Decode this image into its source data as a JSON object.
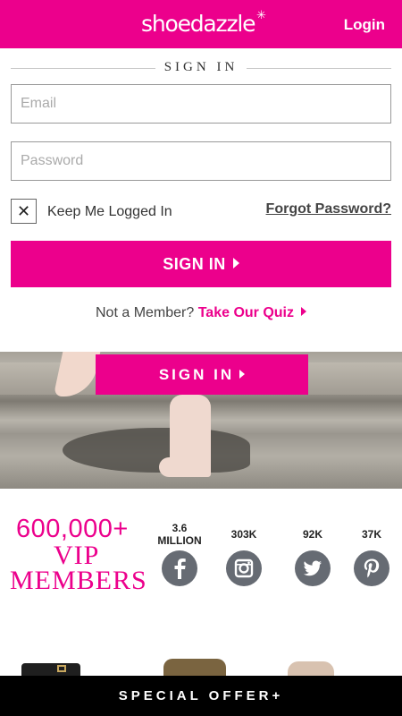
{
  "header": {
    "logo": "shoedazzle",
    "logo_mark": "✳",
    "login_label": "Login"
  },
  "signin": {
    "heading": "SIGN IN",
    "email_placeholder": "Email",
    "password_placeholder": "Password",
    "checkbox_mark": "✕",
    "keep_logged_in": "Keep Me Logged In",
    "forgot_password": "Forgot Password?",
    "button_label": "SIGN IN",
    "not_member": "Not a Member?",
    "quiz_link": "Take Our Quiz"
  },
  "hero": {
    "button_label": "SIGN IN"
  },
  "vip": {
    "number": "600,000+",
    "line1": "VIP",
    "line2": "MEMBERS"
  },
  "social": [
    {
      "count_line1": "3.6",
      "count_line2": "MILLION",
      "icon": "facebook-icon"
    },
    {
      "count_line1": "303K",
      "count_line2": "",
      "icon": "instagram-icon"
    },
    {
      "count_line1": "92K",
      "count_line2": "",
      "icon": "twitter-icon"
    },
    {
      "count_line1": "37K",
      "count_line2": "",
      "icon": "pinterest-icon"
    }
  ],
  "offer": {
    "label": "SPECIAL OFFER+"
  },
  "colors": {
    "brand": "#ec008c",
    "social_icon_bg": "#666b73",
    "offer_bar": "#000000"
  }
}
